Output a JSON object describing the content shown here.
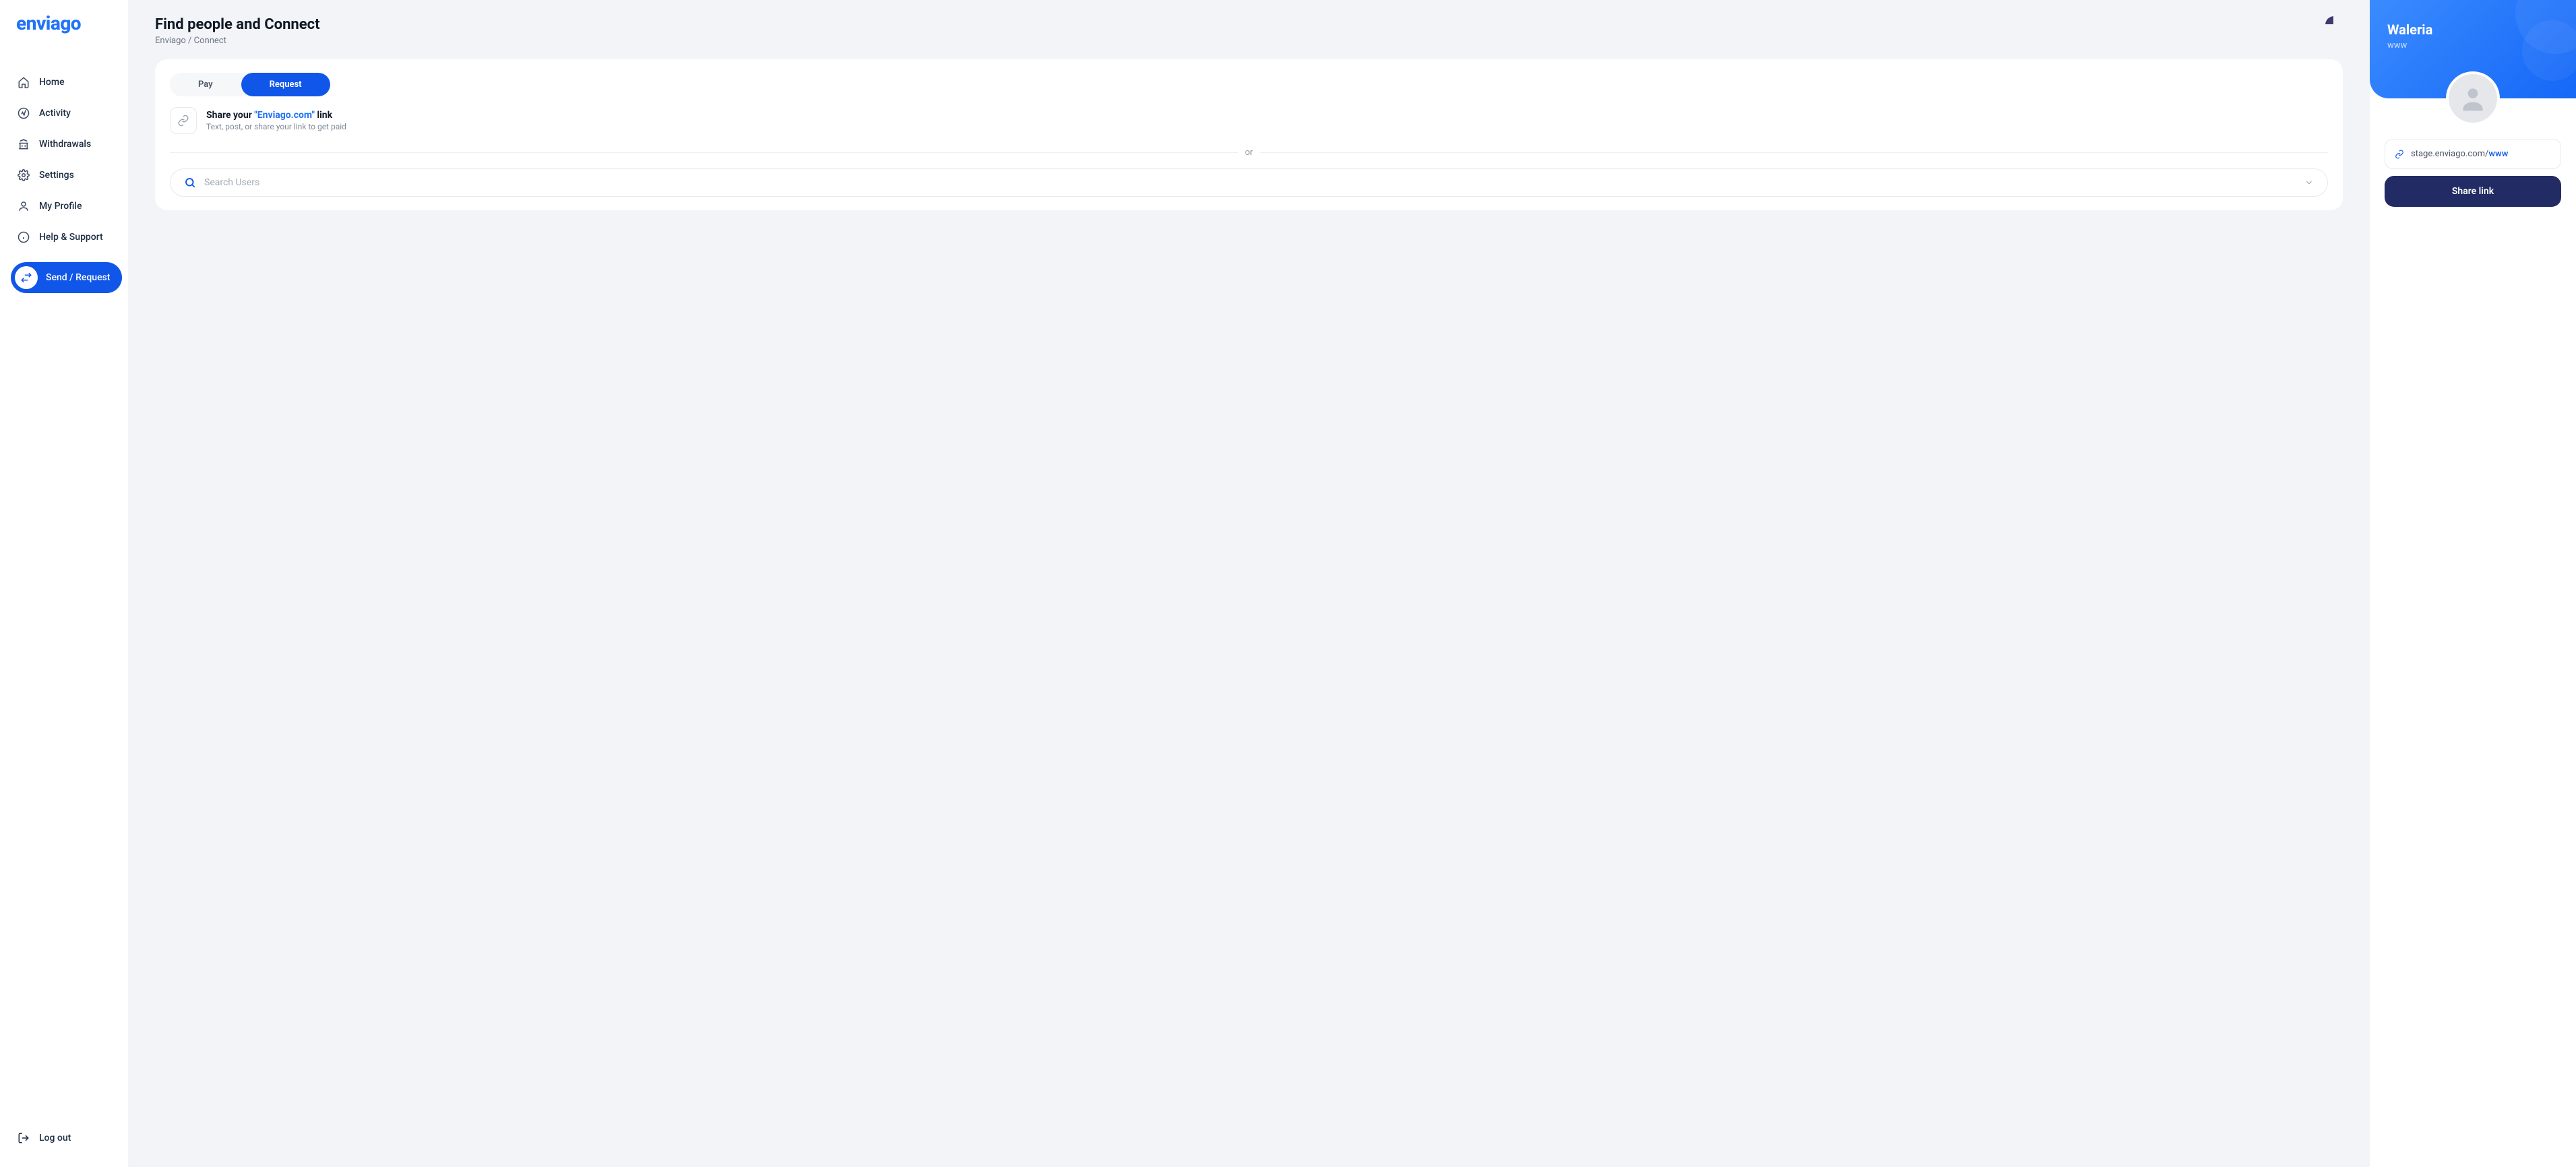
{
  "brand": "enviago",
  "sidebar": {
    "items": [
      {
        "label": "Home"
      },
      {
        "label": "Activity"
      },
      {
        "label": "Withdrawals"
      },
      {
        "label": "Settings"
      },
      {
        "label": "My Profile"
      },
      {
        "label": "Help & Support"
      }
    ],
    "cta_label": "Send / Request",
    "logout_label": "Log out"
  },
  "header": {
    "title": "Find people and Connect",
    "breadcrumb_root": "Enviago",
    "breadcrumb_sep": "/",
    "breadcrumb_current": "Connect"
  },
  "card": {
    "tab_pay": "Pay",
    "tab_request": "Request",
    "share_prefix": "Share your ",
    "share_brand": "\"Enviago.com\"",
    "share_suffix": " link",
    "share_sub": "Text, post, or share your link to get paid",
    "or_label": "or",
    "search_placeholder": "Search Users"
  },
  "profile": {
    "name": "Waleria",
    "handle": "www",
    "link_prefix": "stage.enviago.com/",
    "link_user": "www",
    "share_button": "Share link"
  },
  "colors": {
    "primary": "#1056e8",
    "accent": "#2173f7",
    "dark_button": "#232b64"
  }
}
